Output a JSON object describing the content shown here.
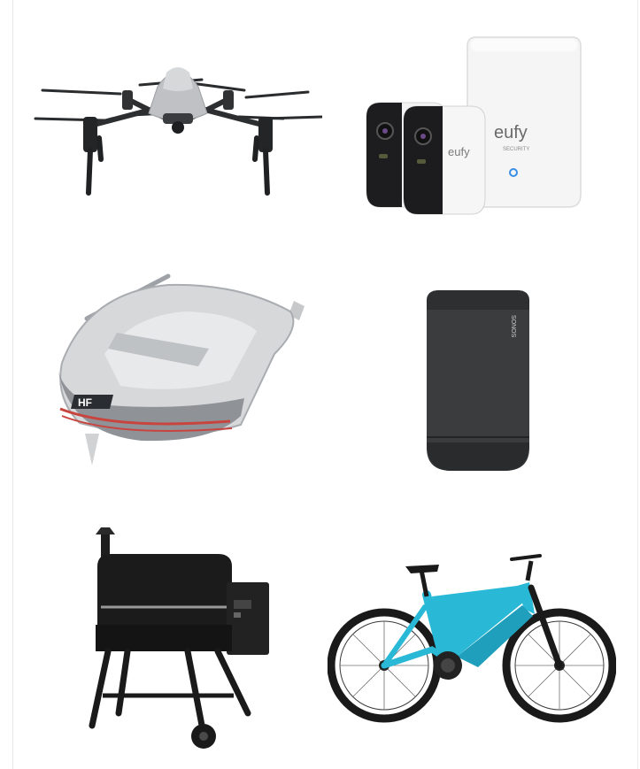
{
  "products": [
    {
      "id": "drone",
      "name": "drone"
    },
    {
      "id": "security-camera-kit",
      "name": "security camera kit",
      "brand_text": "eufy",
      "sub_text": "SECURITY"
    },
    {
      "id": "inflatable-boat",
      "name": "inflatable boat",
      "brand_text": "HF"
    },
    {
      "id": "portable-speaker",
      "name": "portable speaker",
      "brand_text": "SONOS"
    },
    {
      "id": "pellet-grill",
      "name": "pellet grill"
    },
    {
      "id": "electric-mountain-bike",
      "name": "electric mountain bike"
    }
  ],
  "colors": {
    "background": "#ffffff",
    "drone_body": "#b9bbbe",
    "drone_dark": "#222426",
    "camera_white": "#f4f4f4",
    "camera_lens": "#1c1c1e",
    "eufy_blue": "#3a8ee6",
    "boat_light": "#d9dadb",
    "boat_grey": "#8d9196",
    "boat_stripe": "#c8443f",
    "speaker_black": "#3a3b3d",
    "grill_black": "#1b1b1c",
    "bike_cyan": "#29b8d6",
    "bike_black": "#1a1a1a"
  }
}
